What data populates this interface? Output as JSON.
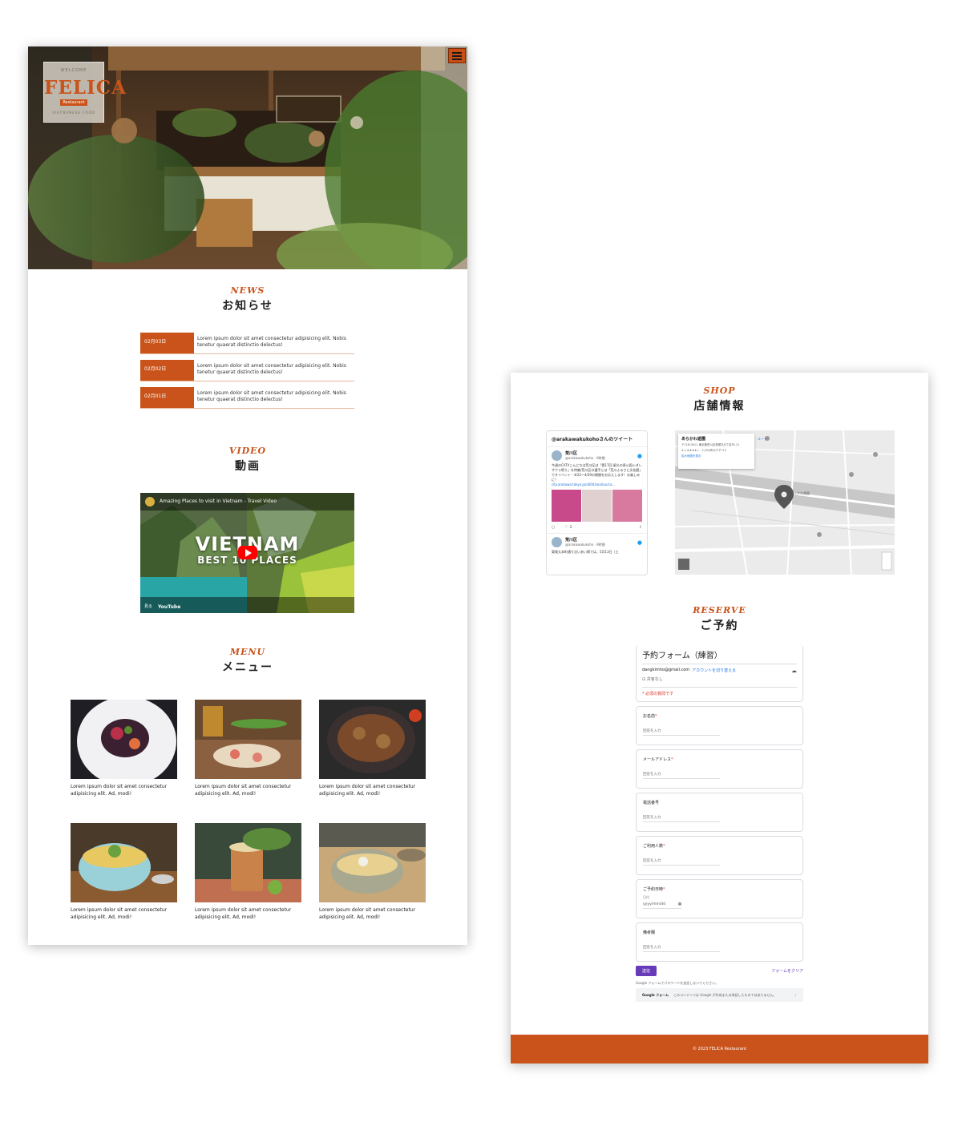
{
  "brand": {
    "logo_top": "WELCOME",
    "logo_name": "FELICA",
    "logo_sub": "Restaurant",
    "logo_bottom": "VIETNAMESE FOOD"
  },
  "colors": {
    "accent": "#c9531a",
    "form_purple": "#673ab7",
    "link_blue": "#1a73e8"
  },
  "sections": {
    "news": {
      "en": "NEWS",
      "jp": "お知らせ"
    },
    "video": {
      "en": "VIDEO",
      "jp": "動画"
    },
    "menu": {
      "en": "MENU",
      "jp": "メニュー"
    },
    "shop": {
      "en": "SHOP",
      "jp": "店舗情報"
    },
    "reserve": {
      "en": "RESERVE",
      "jp": "ご予約"
    }
  },
  "news": [
    {
      "date": "02月03日",
      "text": "Lorem ipsum dolor sit amet consectetur adipisicing elit. Nobis tenetur quaerat distinctio delectus!"
    },
    {
      "date": "02月02日",
      "text": "Lorem ipsum dolor sit amet consectetur adipisicing elit. Nobis tenetur quaerat distinctio delectus!"
    },
    {
      "date": "02月01日",
      "text": "Lorem ipsum dolor sit amet consectetur adipisicing elit. Nobis tenetur quaerat distinctio delectus!"
    }
  ],
  "video": {
    "title": "Amazing Places to visit in Vietnam - Travel Video",
    "big": "VIETNAM",
    "sub": "BEST 10 PLACES",
    "watch": "見る",
    "yt": "YouTube"
  },
  "menu_items": [
    {
      "text": "Lorem ipsum dolor sit amet consectetur adipisicing elit. Ad, modi!",
      "icon": "salad-photo"
    },
    {
      "text": "Lorem ipsum dolor sit amet consectetur adipisicing elit. Ad, modi!",
      "icon": "spring-rolls-photo"
    },
    {
      "text": "Lorem ipsum dolor sit amet consectetur adipisicing elit. Ad, modi!",
      "icon": "noodles-photo"
    },
    {
      "text": "Lorem ipsum dolor sit amet consectetur adipisicing elit. Ad, modi!",
      "icon": "rice-bowl-photo"
    },
    {
      "text": "Lorem ipsum dolor sit amet consectetur adipisicing elit. Ad, modi!",
      "icon": "drink-photo"
    },
    {
      "text": "Lorem ipsum dolor sit amet consectetur adipisicing elit. Ad, modi!",
      "icon": "soup-bowl-photo"
    }
  ],
  "twitter": {
    "header": "@arakawakukohoさんのツイート",
    "name1": "荒川区",
    "handle1": "@arakawakukoho · 9時間",
    "body1": "今週のCATVこんにちは荒川区は「第17回 尾久の原公園シダレザクラ祭り」を特集/荒川区の選手には「荒川ふるさと文化館」ですイベント・4/22〜4/29の期間をお伝えします！お楽しみに！",
    "link1": "city.arakawa.tokyo.jp/a004/souhou/ca...",
    "likes1": "2",
    "name2": "荒川区",
    "handle2": "@arakawakukoho · 9時間",
    "body2": "東尾久本町通り沿いあい際では、5月13日（土"
  },
  "map": {
    "place": "あらかわ遊園",
    "address": "〒116-0011 東京都荒川区西尾久6丁目35-11",
    "rating": "4.1 ★★★★☆ · 1,294件のクチコミ",
    "link": "拡大地図を表示",
    "directions": "ルート"
  },
  "form": {
    "title": "予約フォーム（練習）",
    "account": "dangkimho@gmail.com",
    "switch": "アカウントを切り替える",
    "nosave": "共有なし",
    "required_note": "* 必須の質問です",
    "questions": [
      {
        "label": "お名前",
        "required": "*",
        "placeholder": "回答を入力"
      },
      {
        "label": "メールアドレス",
        "required": "*",
        "placeholder": "回答を入力"
      },
      {
        "label": "電話番号",
        "required": "",
        "placeholder": "回答を入力"
      },
      {
        "label": "ご利用人数",
        "required": "*",
        "placeholder": "回答を入力"
      }
    ],
    "date_question": {
      "label": "ご予約日時",
      "required": "*",
      "sub": "日付",
      "placeholder": "yyyy/mm/dd"
    },
    "remarks": {
      "label": "備考欄",
      "placeholder": "回答を入力"
    },
    "submit": "送信",
    "clear": "フォームをクリア",
    "footer_note": "Google フォームでパスワードを送信しないでください。",
    "footer_brand": "Google フォーム",
    "footer_brand_note": "このコンテンツは Google が作成または承認したものではありません。"
  },
  "footer": {
    "copyright": "© 2023 FELICA Restaurant"
  }
}
